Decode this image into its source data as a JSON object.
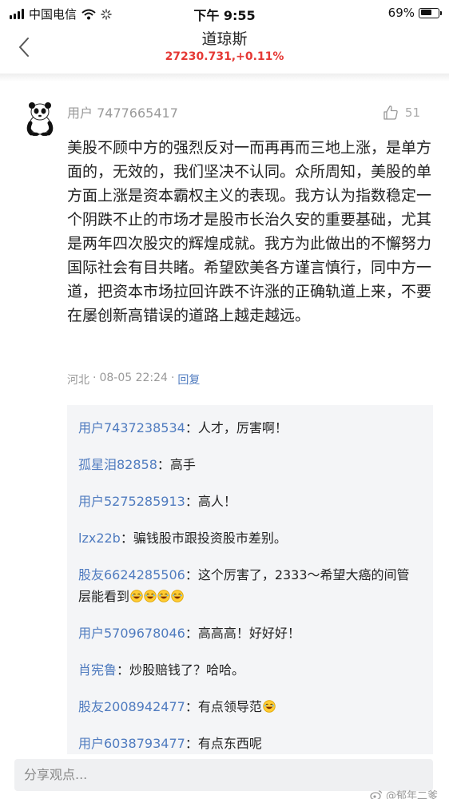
{
  "status_bar": {
    "carrier": "中国电信",
    "time": "下午 9:55",
    "battery_text": "69%",
    "battery_level": 0.69
  },
  "header": {
    "title": "道琼斯",
    "quote": "27230.731,+0.11%"
  },
  "comment": {
    "username": "用户 7477665417",
    "like_count": "51",
    "body": "美股不顾中方的强烈反对一而再再而三地上涨，是单方面的，无效的，我们坚决不认同。众所周知，美股的单方面上涨是资本霸权主义的表现。我方认为指数稳定一个阴跌不止的市场才是股市长治久安的重要基础，尤其是两年四次股灾的辉煌成就。我方为此做出的不懈努力国际社会有目共睹。希望欧美各方谨言慎行，同中方一道，把资本市场拉回许跌不许涨的正确轨道上来，不要在屡创新高错误的道路上越走越远。",
    "location": "河北",
    "datetime": "08-05 22:24",
    "separator": "·",
    "reply_label": "回复"
  },
  "replies": [
    {
      "name": "用户7437238534",
      "text": "：人才，厉害啊！",
      "emoji_count": 0
    },
    {
      "name": "孤星泪82858",
      "text": "：高手",
      "emoji_count": 0
    },
    {
      "name": "用户5275285913",
      "text": "：高人！",
      "emoji_count": 0
    },
    {
      "name": "lzx22b",
      "text": "：骗钱股市跟投资股市差别。",
      "emoji_count": 0
    },
    {
      "name": "股友6624285506",
      "text": "：这个厉害了，2333～希望大癌的间管层能看到",
      "emoji_count": 4
    },
    {
      "name": "用户5709678046",
      "text": "：高高高！好好好！",
      "emoji_count": 0
    },
    {
      "name": "肖宪鲁",
      "text": "：炒股赔钱了？哈哈。",
      "emoji_count": 0
    },
    {
      "name": "股友2008942477",
      "text": "：有点领导范",
      "emoji_count": 1
    },
    {
      "name": "用户6038793477",
      "text": "：有点东西呢",
      "emoji_count": 0
    }
  ],
  "input": {
    "placeholder": "分享观点..."
  },
  "watermark": "@郁年二爹",
  "colors": {
    "accent_blue": "#4f7bbf",
    "quote_red": "#e53935",
    "muted_gray": "#9a9a9a"
  },
  "icons": [
    "signal-icon",
    "wifi-icon",
    "loading-icon",
    "battery-icon",
    "back-chevron-icon",
    "panda-avatar",
    "thumbs-up-icon",
    "laughing-emoji-icon",
    "weibo-logo-icon"
  ]
}
